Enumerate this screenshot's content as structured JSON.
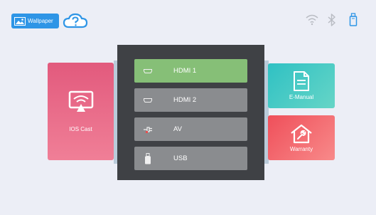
{
  "topbar": {
    "wallpaper_label": "Wallpaper",
    "icons": [
      "image-icon",
      "help-cloud-icon",
      "wifi-icon",
      "bluetooth-icon",
      "usb-drive-icon"
    ]
  },
  "tiles": {
    "ios_cast": "IOS Cast",
    "e_manual": "E-Manual",
    "warranty": "Warranty"
  },
  "source_menu": {
    "items": [
      {
        "label": "HDMI 1",
        "icon": "hdmi-port-icon",
        "selected": true
      },
      {
        "label": "HDMI 2",
        "icon": "hdmi-port-icon",
        "selected": false
      },
      {
        "label": "AV",
        "icon": "av-plug-icon",
        "selected": false
      },
      {
        "label": "USB",
        "icon": "usb-stick-icon",
        "selected": false
      }
    ]
  },
  "colors": {
    "background": "#eceef6",
    "accent_blue": "#2e95e6",
    "panel": "#3f4145",
    "selected_item": "#86bf77",
    "item": "#8a8c8f",
    "ios_tile": "#e25a7d",
    "manual_tile": "#2fc1c4",
    "warranty_tile": "#ef4f5a"
  }
}
